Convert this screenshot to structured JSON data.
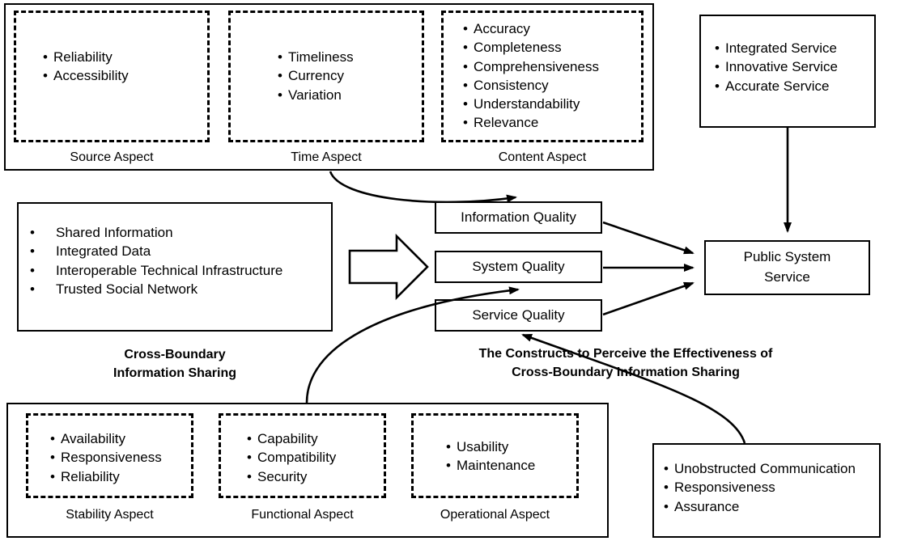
{
  "diagram": {
    "title": "Constructs to Perceive the Effectiveness of Cross-Boundary Information Sharing",
    "captions": {
      "left_group": "Cross-Boundary\nInformation Sharing",
      "left_group_line1": "Cross-Boundary",
      "left_group_line2": "Information Sharing",
      "center_group_line1": "The Constructs to Perceive the Effectiveness of",
      "center_group_line2": "Cross-Boundary Information Sharing"
    }
  },
  "information_quality_group": {
    "aspects": [
      {
        "label": "Source Aspect",
        "items": [
          "Reliability",
          "Accessibility"
        ]
      },
      {
        "label": "Time Aspect",
        "items": [
          "Timeliness",
          "Currency",
          "Variation"
        ]
      },
      {
        "label": "Content Aspect",
        "items": [
          "Accuracy",
          "Completeness",
          "Comprehensiveness",
          "Consistency",
          "Understandability",
          "Relevance"
        ]
      }
    ]
  },
  "public_service_outcomes": {
    "items": [
      "Integrated Service",
      "Innovative Service",
      "Accurate Service"
    ]
  },
  "cross_boundary_information_sharing": {
    "items": [
      "Shared Information",
      "Integrated Data",
      "Interoperable Technical Infrastructure",
      "Trusted Social Network"
    ]
  },
  "quality_constructs": {
    "items": [
      {
        "label": "Information Quality"
      },
      {
        "label": "System Quality"
      },
      {
        "label": "Service Quality"
      }
    ]
  },
  "outcome": {
    "label_line1": "Public System",
    "label_line2": "Service",
    "label": "Public System Service"
  },
  "system_quality_group": {
    "aspects": [
      {
        "label": "Stability Aspect",
        "items": [
          "Availability",
          "Responsiveness",
          "Reliability"
        ]
      },
      {
        "label": "Functional Aspect",
        "items": [
          "Capability",
          "Compatibility",
          "Security"
        ]
      },
      {
        "label": "Operational Aspect",
        "items": [
          "Usability",
          "Maintenance"
        ]
      }
    ]
  },
  "service_quality_group": {
    "items": [
      "Unobstructed Communication",
      "Responsiveness",
      "Assurance"
    ]
  },
  "colors": {
    "stroke": "#000000",
    "background": "#ffffff"
  }
}
